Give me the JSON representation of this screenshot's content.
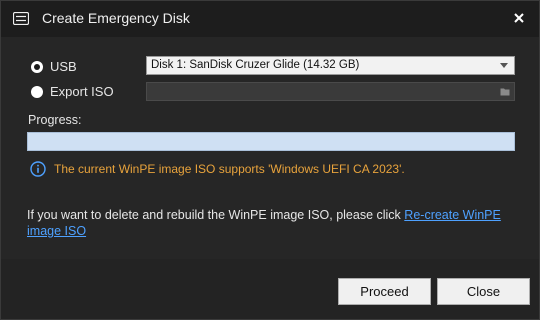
{
  "window": {
    "title": "Create Emergency Disk"
  },
  "target": {
    "usb_label": "USB",
    "export_label": "Export ISO",
    "selected": "usb",
    "usb_disk": "Disk 1: SanDisk Cruzer Glide (14.32 GB)",
    "export_path": ""
  },
  "progress": {
    "label": "Progress:",
    "value": 0
  },
  "info": {
    "text": "The current WinPE image ISO supports 'Windows UEFI CA 2023'."
  },
  "note": {
    "text": "If you want to delete and rebuild the WinPE image ISO, please click ",
    "link": "Re-create WinPE image ISO"
  },
  "buttons": {
    "proceed": "Proceed",
    "close": "Close"
  },
  "colors": {
    "info_text": "#e8a33c",
    "link": "#4ea1ff",
    "progress_track": "#cfe0f3"
  },
  "icons": {
    "app": "usb-disk-icon",
    "close": "close-icon",
    "info": "info-icon",
    "folder": "folder-icon",
    "dropdown": "chevron-down-icon"
  }
}
